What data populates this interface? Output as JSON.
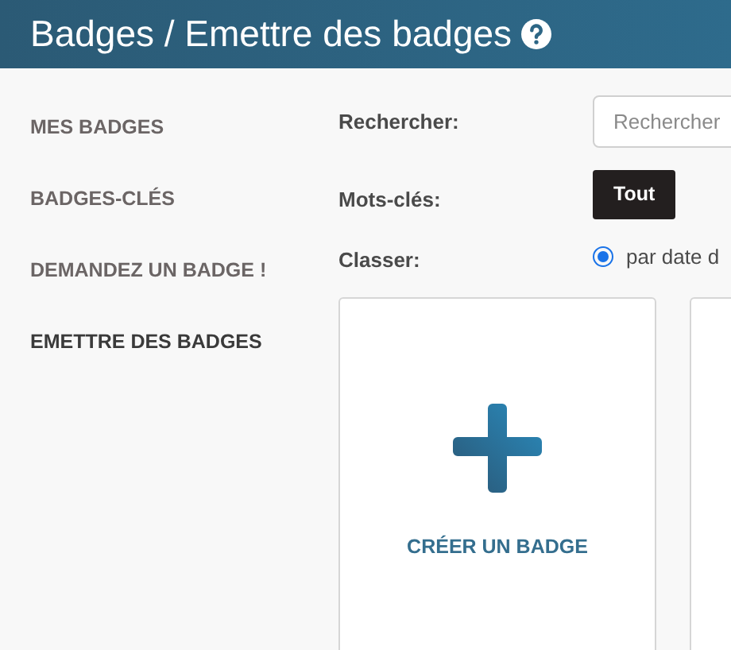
{
  "header": {
    "title": "Badges / Emettre des badges"
  },
  "sidebar": {
    "items": [
      {
        "label": "MES BADGES",
        "selected": false
      },
      {
        "label": "BADGES-CLÉS",
        "selected": false
      },
      {
        "label": "DEMANDEZ UN BADGE !",
        "selected": false
      },
      {
        "label": "EMETTRE DES BADGES",
        "selected": true
      }
    ]
  },
  "filters": {
    "search_label": "Rechercher:",
    "search": {
      "placeholder": "Rechercher"
    },
    "keywords_label": "Mots-clés:",
    "keyword_button": "Tout",
    "sort_label": "Classer:",
    "sort_option": {
      "label": "par date d",
      "selected": true
    }
  },
  "cards": [
    {
      "kind": "create",
      "label": "CRÉER UN BADGE"
    },
    {
      "kind": "empty"
    }
  ]
}
